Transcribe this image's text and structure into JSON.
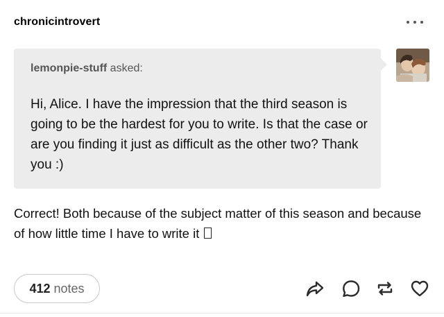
{
  "post": {
    "username": "chronicintrovert",
    "more_icon": "ellipsis-icon"
  },
  "ask": {
    "asker": "lemonpie-stuff",
    "asked_label": "asked:",
    "question": "Hi, Alice. I have the impression that the third season is going to be the hardest for you to write. Is that the case or are you finding it just as difficult as the other two? Thank you :)"
  },
  "answer": {
    "text": "Correct! Both because of the subject matter of this season and because of how little time I have to write it"
  },
  "footer": {
    "notes_count": "412",
    "notes_label": "notes",
    "icons": [
      "share-icon",
      "reply-icon",
      "reblog-icon",
      "like-icon"
    ]
  },
  "colors": {
    "ask_background": "#ececec",
    "icon_color": "#2b2b2b",
    "muted_text": "#555555"
  }
}
